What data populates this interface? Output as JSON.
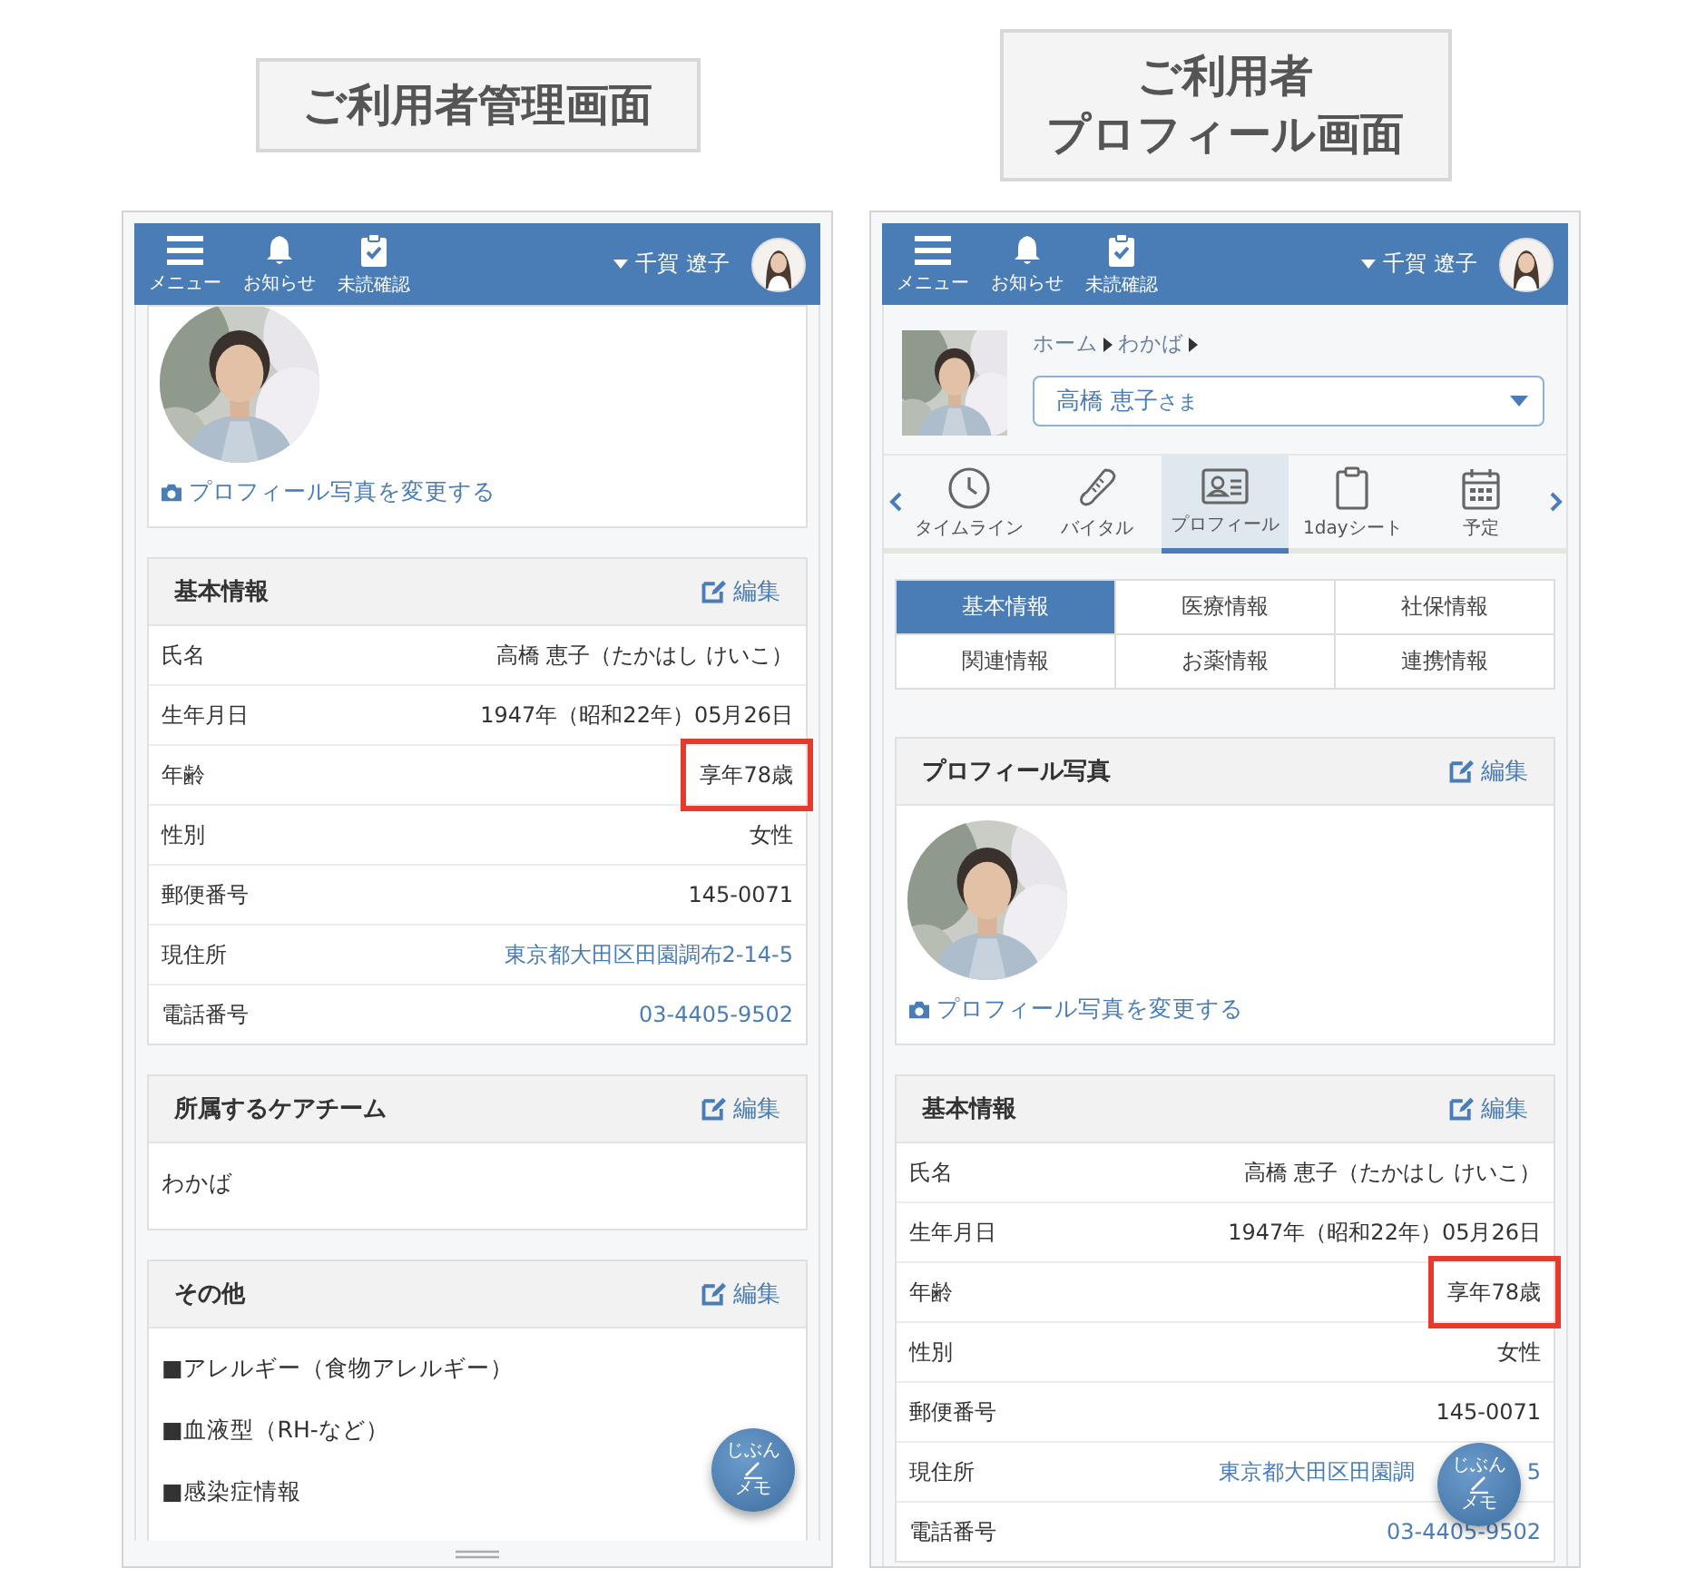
{
  "screens": [
    {
      "caption": [
        "ご利用者管理画面"
      ],
      "header": {
        "items": [
          {
            "kind": "menu",
            "label": "メニュー"
          },
          {
            "kind": "bell",
            "label": "お知らせ"
          },
          {
            "kind": "check",
            "label": "未読確認"
          }
        ],
        "user": "千賀 遼子"
      },
      "blocks": [
        {
          "link": "プロフィール写真を変更する"
        },
        {
          "kind": "info",
          "title": "基本情報",
          "edit": "編集",
          "rows": [
            {
              "label": "氏名",
              "value": "高橋 恵子（たかはし けいこ）",
              "link": false,
              "highlighted": false
            },
            {
              "label": "生年月日",
              "value": "1947年（昭和22年）05月26日",
              "link": false,
              "highlighted": false
            },
            {
              "label": "年齢",
              "value": "享年78歳",
              "link": false,
              "highlighted": true
            },
            {
              "label": "性別",
              "value": "女性",
              "link": false,
              "highlighted": false
            },
            {
              "label": "郵便番号",
              "value": "145-0071",
              "link": false,
              "highlighted": false
            },
            {
              "label": "現住所",
              "value": "東京都大田区田園調布2-14-5",
              "link": true,
              "highlighted": false
            },
            {
              "label": "電話番号",
              "value": "03-4405-9502",
              "link": true,
              "highlighted": false
            }
          ]
        },
        {
          "kind": "text",
          "title": "所属するケアチーム",
          "edit": "編集",
          "text": "わかば"
        },
        {
          "kind": "list",
          "title": "その他",
          "edit": "編集",
          "items": [
            "■アレルギー（食物アレルギー）",
            "■血液型（RH-など）",
            "■感染症情報"
          ]
        }
      ],
      "fab": {
        "top": "じぶん",
        "bottom": "メモ"
      },
      "resize_handle": true
    },
    {
      "caption": [
        "ご利用者",
        "プロフィール画面"
      ],
      "header": {
        "items": [
          {
            "kind": "menu",
            "label": "メニュー"
          },
          {
            "kind": "bell",
            "label": "お知らせ"
          },
          {
            "kind": "check",
            "label": "未読確認"
          }
        ],
        "user": "千賀 遼子"
      },
      "blocks": [
        {
          "kind": "patient",
          "breadcrumb": [
            "ホーム",
            "わかば"
          ],
          "name": "高橋 恵子",
          "honorific": "さま"
        },
        {
          "kind": "nav",
          "tabs": [
            {
              "label": "タイムライン",
              "selected": false
            },
            {
              "label": "バイタル",
              "selected": false
            },
            {
              "label": "プロフィール",
              "selected": true
            },
            {
              "label": "1dayシート",
              "selected": false
            },
            {
              "label": "予定",
              "selected": false
            }
          ]
        },
        {
          "kind": "subtabs",
          "items": [
            {
              "label": "基本情報",
              "selected": true
            },
            {
              "label": "医療情報",
              "selected": false
            },
            {
              "label": "社保情報",
              "selected": false
            },
            {
              "label": "関連情報",
              "selected": false
            },
            {
              "label": "お薬情報",
              "selected": false
            },
            {
              "label": "連携情報",
              "selected": false
            }
          ]
        },
        {
          "title": "プロフィール写真",
          "edit": "編集",
          "link": "プロフィール写真を変更する"
        },
        {
          "kind": "info",
          "title": "基本情報",
          "edit": "編集",
          "rows": [
            {
              "label": "氏名",
              "value": "高橋 恵子（たかはし けいこ）",
              "link": false,
              "highlighted": false
            },
            {
              "label": "生年月日",
              "value": "1947年（昭和22年）05月26日",
              "link": false,
              "highlighted": false
            },
            {
              "label": "年齢",
              "value": "享年78歳",
              "link": false,
              "highlighted": true
            },
            {
              "label": "性別",
              "value": "女性",
              "link": false,
              "highlighted": false
            },
            {
              "label": "郵便番号",
              "value": "145-0071",
              "link": false,
              "highlighted": false
            },
            {
              "label": "現住所",
              "value": "東京都大田区田園調",
              "tail": "5",
              "link": true,
              "highlighted": false
            },
            {
              "label": "電話番号",
              "value": "03-4405-9502",
              "link": true,
              "highlighted": false
            }
          ]
        }
      ],
      "fab": {
        "top": "じぶん",
        "bottom": "メモ"
      },
      "resize_handle": false
    }
  ]
}
